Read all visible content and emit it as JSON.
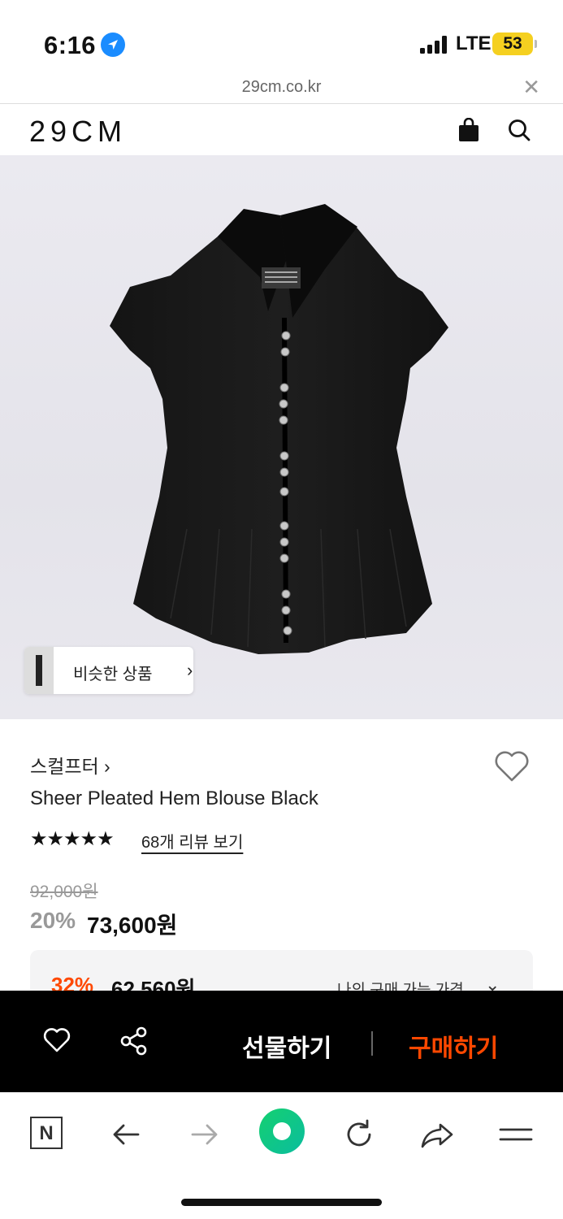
{
  "status_bar": {
    "time": "6:16",
    "network": "LTE",
    "battery": "53",
    "icons": [
      "location-arrow-icon",
      "signal-bars-icon"
    ]
  },
  "browser": {
    "url": "29cm.co.kr",
    "close_icon": "close-icon",
    "toolbar_icons": [
      "naver-n-icon",
      "back-arrow-icon",
      "forward-arrow-icon",
      "home-green-circle-icon",
      "reload-icon",
      "share-arrow-icon",
      "menu-icon"
    ]
  },
  "site_header": {
    "logo": "29CM",
    "icons": [
      "shopping-bag-icon",
      "search-icon"
    ]
  },
  "hero": {
    "image_subject": "black sheer blouse",
    "similar_products_label": "비슷한 상품"
  },
  "product": {
    "brand": "스컬프터",
    "brand_chevron": "›",
    "title": "Sheer Pleated Hem Blouse Black",
    "rating_stars": "★★★★★",
    "rating_value": 4.5,
    "review_link": "68개 리뷰 보기",
    "original_price": "92,000원",
    "discount_percent": "20%",
    "sale_price": "73,600원",
    "my_price": {
      "percent": "32%",
      "price": "62,560원",
      "label": "나의 구매 가능 가격"
    }
  },
  "buy_bar": {
    "gift_label": "선물하기",
    "buy_label": "구매하기",
    "accent_color": "#ff4800"
  }
}
